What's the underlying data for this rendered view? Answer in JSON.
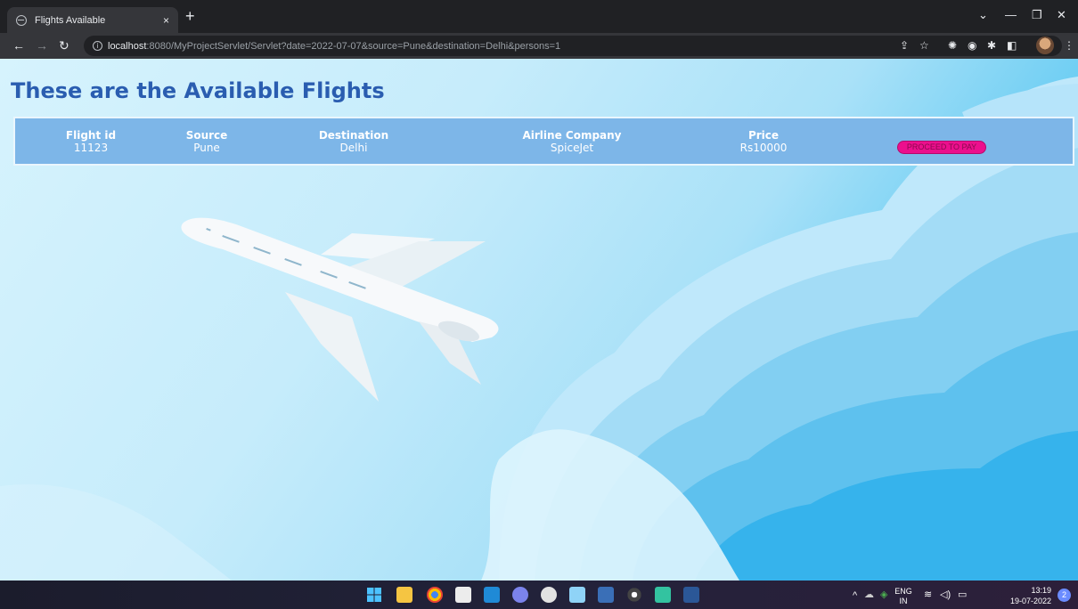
{
  "browser": {
    "tab_title": "Flights Available",
    "tab_close": "×",
    "new_tab": "+",
    "url_host": "localhost",
    "url_path": ":8080/MyProjectServlet/Servlet?date=2022-07-07&source=Pune&destination=Delhi&persons=1"
  },
  "page": {
    "heading": "These are the Available Flights",
    "columns": [
      {
        "header": "Flight id",
        "value": "11123"
      },
      {
        "header": "Source",
        "value": "Pune"
      },
      {
        "header": "Destination",
        "value": "Delhi"
      },
      {
        "header": "Airline Company",
        "value": "SpiceJet"
      },
      {
        "header": "Price",
        "value": "Rs10000"
      }
    ],
    "pay_button": "PROCEED TO PAY"
  },
  "taskbar": {
    "lang_top": "ENG",
    "lang_bottom": "IN",
    "time": "13:19",
    "date": "19-07-2022",
    "notifications": "2"
  },
  "colors": {
    "heading": "#2a5db0",
    "table_bg": "#7db6e8",
    "pay_button": "#ec0f8d"
  }
}
